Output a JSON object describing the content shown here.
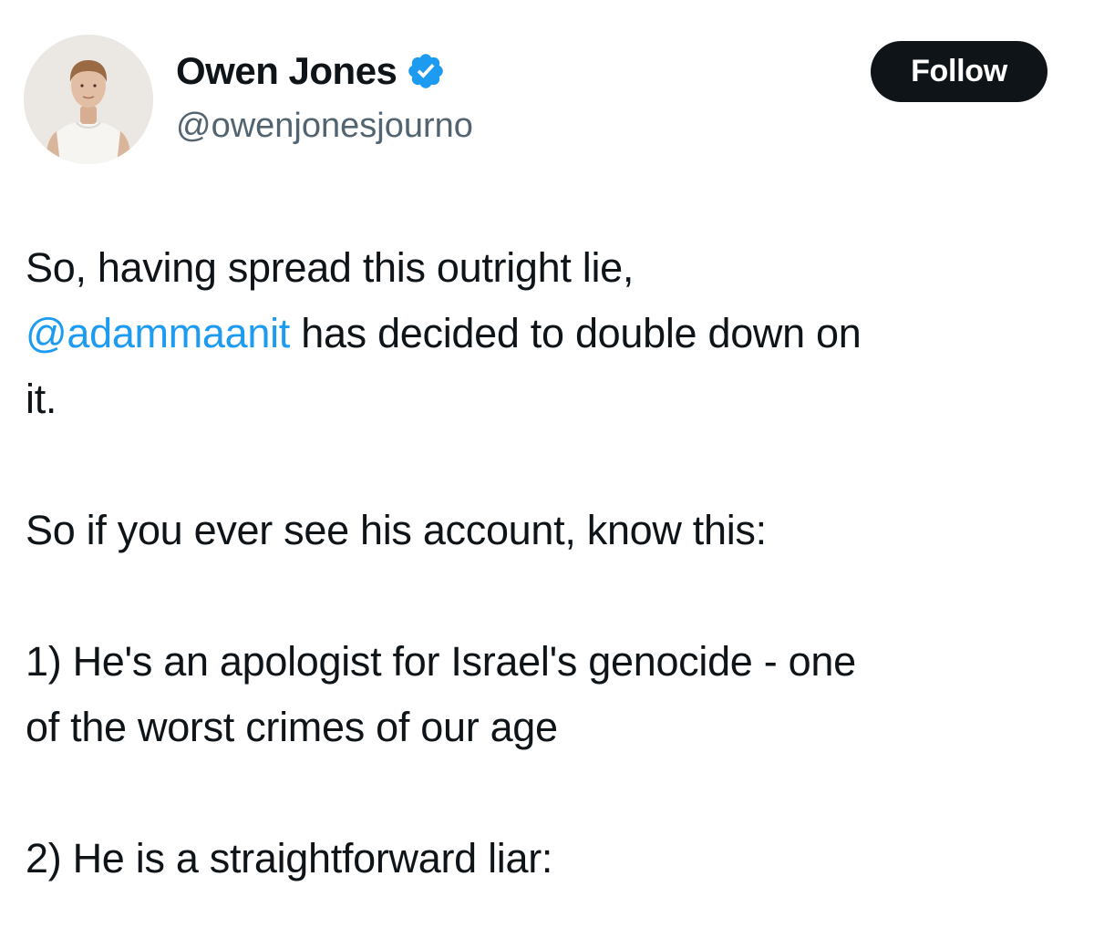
{
  "author": {
    "display_name": "Owen Jones",
    "handle": "@owenjonesjourno",
    "verified": true,
    "verified_color": "#1d9bf0"
  },
  "follow_button": {
    "label": "Follow"
  },
  "tweet": {
    "paragraph_1": {
      "line_1": "So, having spread this outright lie,",
      "mention": "@adammaanit",
      "after_mention": " has decided to double down on",
      "line_3": "it."
    },
    "paragraph_2": "So if you ever see his account, know this:",
    "paragraph_3": {
      "line_1": "1) He's an apologist for Israel's genocide - one",
      "line_2": "of the worst crimes of our age"
    },
    "paragraph_4": "2) He is a straightforward liar:"
  },
  "colors": {
    "text": "#0f1419",
    "secondary_text": "#536471",
    "link": "#1d9bf0",
    "button_bg": "#0f1419",
    "button_text": "#ffffff"
  }
}
